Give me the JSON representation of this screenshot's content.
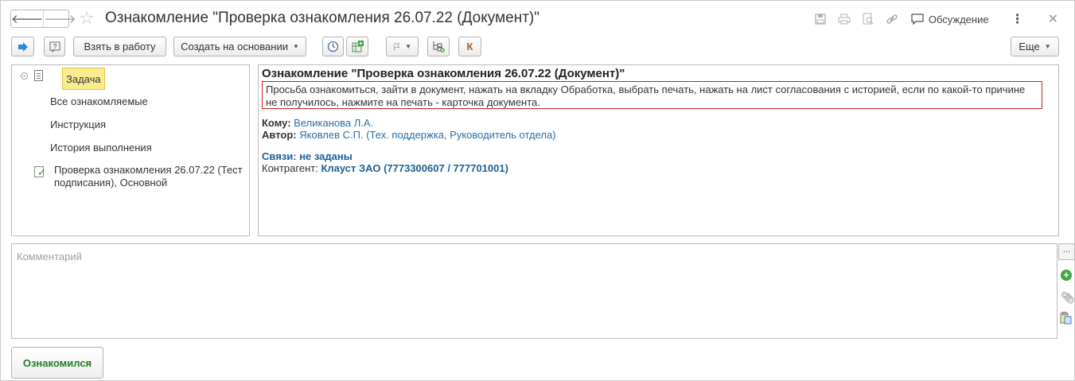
{
  "window": {
    "title": "Ознакомление \"Проверка ознакомления 26.07.22 (Документ)\"",
    "discussion_label": "Обсуждение"
  },
  "toolbar": {
    "take_to_work": "Взять в работу",
    "create_based_on": "Создать на основании",
    "k_label": "К",
    "more": "Еще"
  },
  "tree": {
    "task": "Задача",
    "items": [
      "Все ознакомляемые",
      "Инструкция",
      "История выполнения"
    ],
    "document": "Проверка ознакомления 26.07.22 (Тест подписания), Основной"
  },
  "details": {
    "heading": "Ознакомление \"Проверка ознакомления 26.07.22 (Документ)\"",
    "message": "Просьба ознакомиться, зайти в документ, нажать на вкладку Обработка, выбрать печать, нажать на лист согласования с историей, если по какой-то причине не получилось, нажмите на печать - карточка документа.",
    "to_label": "Кому:",
    "to_value": "Великанова Л.А.",
    "author_label": "Автор:",
    "author_value": "Яковлев С.П. (Тех. поддержка, Руководитель отдела)",
    "links_label": "Связи: не заданы",
    "counterparty_label": "Контрагент:",
    "counterparty_value": "Клауст ЗАО (7773300607 / 777701001)"
  },
  "comment": {
    "placeholder": "Комментарий",
    "dots": "..."
  },
  "actions": {
    "acknowledge": "Ознакомился"
  },
  "colors": {
    "accent_blue": "#2a6ea6",
    "highlight": "#fbec8e",
    "message_border": "#cc1f1f",
    "ack_green": "#1e7b1e"
  }
}
